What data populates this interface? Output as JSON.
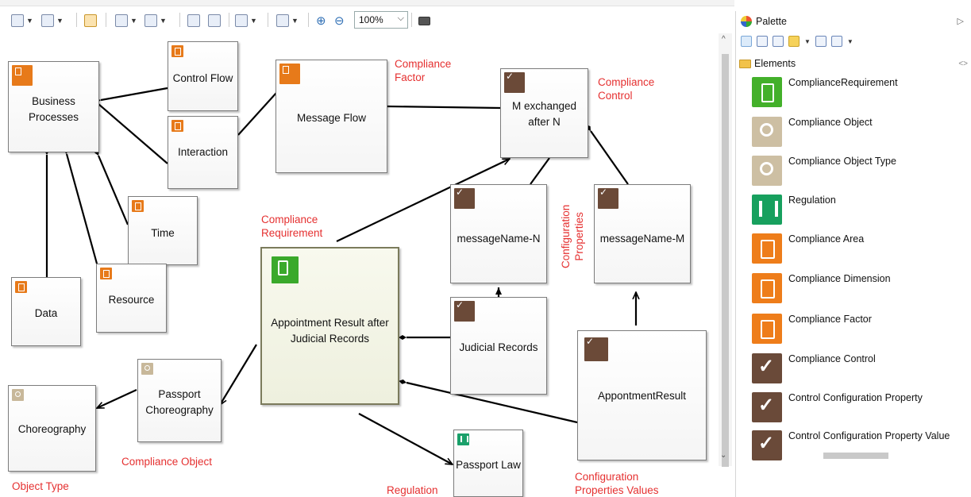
{
  "toolbar": {
    "zoom_value": "100%",
    "icons": [
      "layout-icon",
      "arrange-icon",
      "link-icon",
      "select-icon",
      "filter-icon",
      "view-icon",
      "export-icon",
      "align-icon",
      "clipboard-icon",
      "zoom-in-icon",
      "zoom-out-icon",
      "camera-icon"
    ]
  },
  "nodes": {
    "business_processes": "Business\nProcesses",
    "control_flow": "Control Flow",
    "interaction": "Interaction",
    "message_flow": "Message Flow",
    "m_exchanged": "M exchanged\nafter N",
    "time": "Time",
    "data": "Data",
    "resource": "Resource",
    "message_name_n": "messageName-N",
    "message_name_m": "messageName-M",
    "appointment_result": "Appointment Result after\nJudicial Records",
    "judicial_records": "Judicial Records",
    "appontment_result": "AppontmentResult",
    "passport_choreography": "Passport\nChoreography",
    "choreography": "Choreography",
    "passport_law": "Passport Law"
  },
  "annotations": {
    "compliance_factor": "Compliance\nFactor",
    "compliance_control": "Compliance\nControl",
    "compliance_requirement": "Compliance\nRequirement",
    "configuration_properties": "Configuration\nProperties",
    "compliance_object": "Compliance Object",
    "object_type": "Object Type",
    "regulation": "Regulation",
    "configuration_properties_values": "Configuration\nProperties Values"
  },
  "palette": {
    "title": "Palette",
    "section": "Elements",
    "items": [
      {
        "label": "ComplianceRequirement",
        "icon": "compliance-requirement-icon",
        "color": "#43b02a"
      },
      {
        "label": "Compliance Object",
        "icon": "magnifier-icon",
        "color": "#cdbfa3"
      },
      {
        "label": "Compliance Object Type",
        "icon": "magnifier-icon",
        "color": "#cdbfa3"
      },
      {
        "label": "Regulation",
        "icon": "books-icon",
        "color": "#17a05e"
      },
      {
        "label": "Compliance Area",
        "icon": "clipboard-icon",
        "color": "#ee7d1a"
      },
      {
        "label": "Compliance Dimension",
        "icon": "clipboard-icon",
        "color": "#ee7d1a"
      },
      {
        "label": "Compliance Factor",
        "icon": "clipboard-icon",
        "color": "#ee7d1a"
      },
      {
        "label": "Compliance Control",
        "icon": "checkbox-icon",
        "color": "#6a4a39"
      },
      {
        "label": "Control Configuration Property",
        "icon": "checkbox-icon",
        "color": "#6a4a39"
      },
      {
        "label": "Control Configuration Property Value",
        "icon": "checkbox-icon",
        "color": "#6a4a39"
      }
    ]
  }
}
